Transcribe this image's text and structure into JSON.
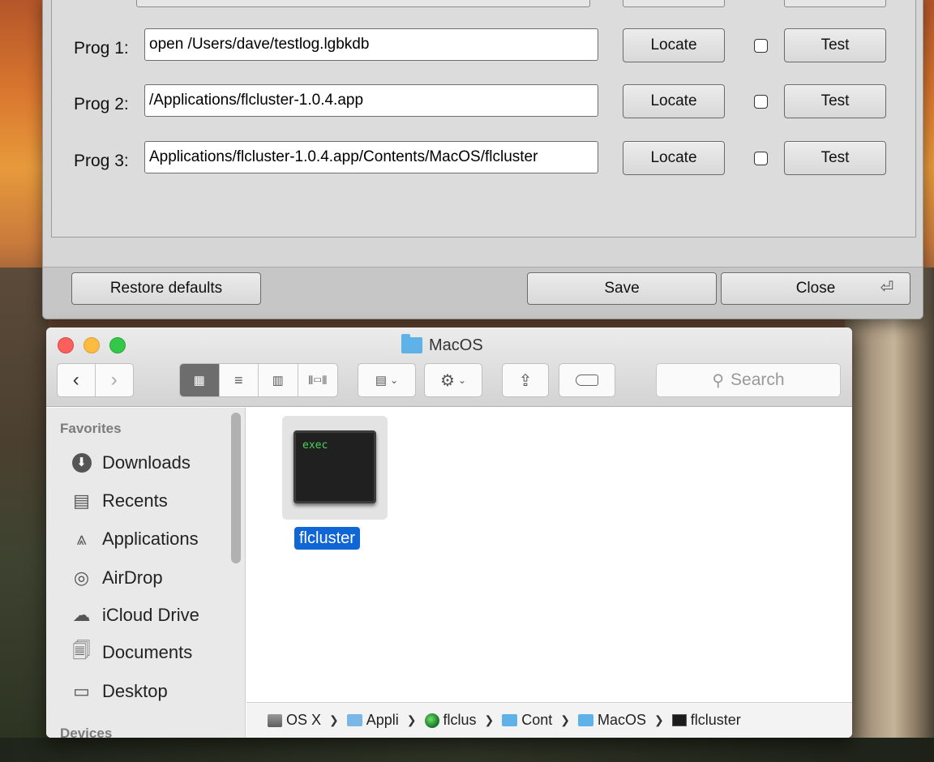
{
  "prefs": {
    "rows": [
      {
        "label": "Prog 1:",
        "value": "open /Users/dave/testlog.lgbkdb",
        "locate": "Locate",
        "test": "Test"
      },
      {
        "label": "Prog 2:",
        "value": "/Applications/flcluster-1.0.4.app",
        "locate": "Locate",
        "test": "Test"
      },
      {
        "label": "Prog 3:",
        "value": "Applications/flcluster-1.0.4.app/Contents/MacOS/flcluster",
        "locate": "Locate",
        "test": "Test"
      }
    ],
    "footer": {
      "restore": "Restore defaults",
      "save": "Save",
      "close": "Close"
    }
  },
  "finder": {
    "title": "MacOS",
    "search_placeholder": "Search",
    "sidebar": {
      "favorites_heading": "Favorites",
      "items": [
        {
          "label": "Downloads",
          "icon": "downloads-icon"
        },
        {
          "label": "Recents",
          "icon": "recents-icon"
        },
        {
          "label": "Applications",
          "icon": "applications-icon"
        },
        {
          "label": "AirDrop",
          "icon": "airdrop-icon"
        },
        {
          "label": "iCloud Drive",
          "icon": "cloud-icon"
        },
        {
          "label": "Documents",
          "icon": "documents-icon"
        },
        {
          "label": "Desktop",
          "icon": "desktop-icon"
        }
      ],
      "devices_heading": "Devices"
    },
    "file": {
      "name": "flcluster",
      "icon_text": "exec"
    },
    "pathbar": [
      "OS X",
      "Appli",
      "flclus",
      "Cont",
      "MacOS",
      "flcluster"
    ]
  },
  "colors": {
    "selection": "#1166d6",
    "folder": "#5fb2e8",
    "close": "#fc605c",
    "minimize": "#fdbc40",
    "zoom": "#34c84a"
  }
}
